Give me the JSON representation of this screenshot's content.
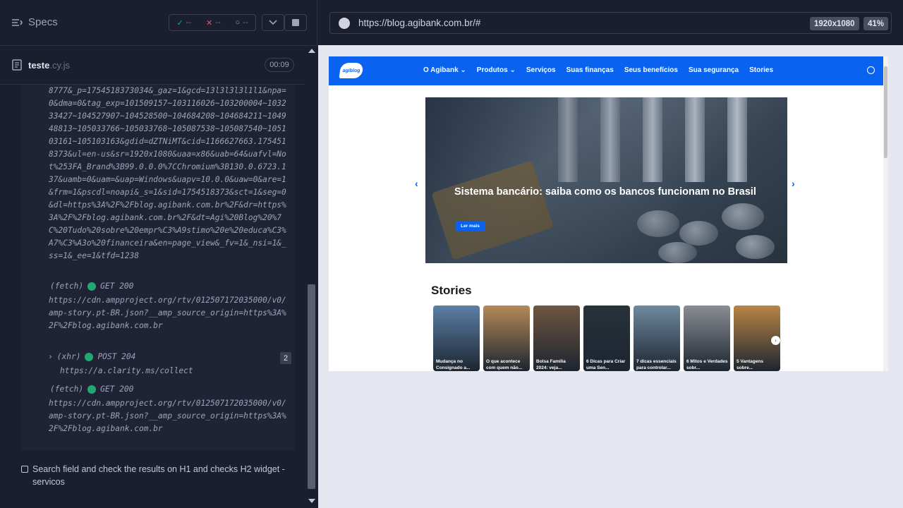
{
  "left_panel": {
    "specs_label": "Specs",
    "stats": {
      "passed": "--",
      "failed": "--",
      "pending": "--"
    },
    "file": {
      "name": "teste",
      "ext": ".cy.js",
      "time": "00:09"
    },
    "log": {
      "query_text": "8777&_p=1754518373034&_gaz=1&gcd=13l3l3l3l1l1&npa=0&dma=0&tag_exp=101509157~103116026~103200004~103233427~104527907~104528500~104684208~104684211~104948813~105033766~105033768~105087538~105087540~105103161~105103163&gdid=dZTNiMT&cid=1166627663.1754518373&ul=en-us&sr=1920x1080&uaa=x86&uab=64&uafvl=Not%253FA_Brand%3B99.0.0.0%7CChromium%3B130.0.6723.137&uamb=0&uam=&uap=Windows&uapv=10.0.0&uaw=0&are=1&frm=1&pscdl=noapi&_s=1&sid=1754518373&sct=1&seg=0&dl=https%3A%2F%2Fblog.agibank.com.br%2F&dr=https%3A%2F%2Fblog.agibank.com.br%2F&dt=Agi%20Blog%20%7C%20Tudo%20sobre%20empr%C3%A9stimo%20e%20educa%C3%A7%C3%A3o%20financeira&en=page_view&_fv=1&_nsi=1&_ss=1&_ee=1&tfd=1238",
      "fetch1": {
        "kind": "(fetch)",
        "method": "GET 200",
        "url": "https://cdn.ampproject.org/rtv/012507172035000/v0/amp-story.pt-BR.json?__amp_source_origin=https%3A%2F%2Fblog.agibank.com.br"
      },
      "xhr": {
        "kind": "(xhr)",
        "method": "POST 204",
        "url": "https://a.clarity.ms/collect",
        "count": "2"
      },
      "fetch2": {
        "kind": "(fetch)",
        "method": "GET 200",
        "url": "https://cdn.ampproject.org/rtv/012507172035000/v0/amp-story.pt-BR.json?__amp_source_origin=https%3A%2F%2Fblog.agibank.com.br"
      }
    },
    "test_label": "Search field and check the results on H1 and checks H2 widget - servicos"
  },
  "browser": {
    "url": "https://blog.agibank.com.br/#",
    "resolution": "1920x1080",
    "zoom": "41%"
  },
  "site": {
    "logo_text": "agiblog",
    "nav": [
      "O Agibank",
      "Produtos",
      "Serviços",
      "Suas finanças",
      "Seus benefícios",
      "Sua segurança",
      "Stories"
    ],
    "hero": {
      "title": "Sistema bancário: saiba como os bancos funcionam no Brasil",
      "button": "Ler mais"
    },
    "stories_title": "Stories",
    "stories": [
      {
        "caption": "Mudança no Consignado a...",
        "color": "#5b7fa6"
      },
      {
        "caption": "O que acontece com quem não...",
        "color": "#b48a58"
      },
      {
        "caption": "Bolsa Família 2024: veja...",
        "color": "#6f5640"
      },
      {
        "caption": "6 Dicas para Criar uma Sen...",
        "color": "#27323a"
      },
      {
        "caption": "7 dicas essenciais para controlar...",
        "color": "#6e8aa0"
      },
      {
        "caption": "6 Mitos e Verdades sobr...",
        "color": "#8a8d93"
      },
      {
        "caption": "5 Vantagens sobre...",
        "color": "#b98545"
      }
    ]
  }
}
